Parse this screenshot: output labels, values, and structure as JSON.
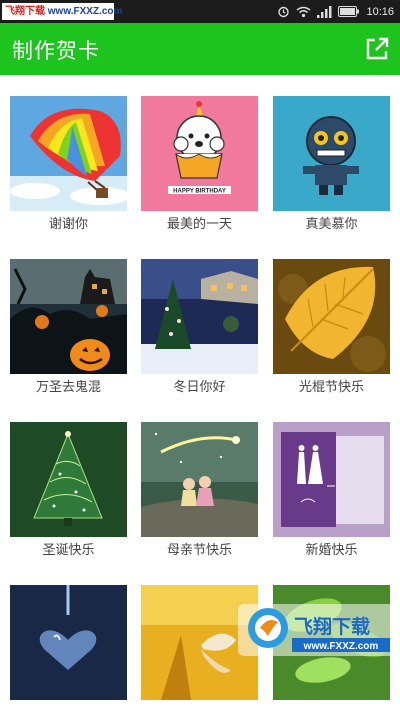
{
  "status_bar": {
    "watermark_red": "飞翔下载",
    "watermark_blue": " www.FXXZ.com",
    "time": "10:16",
    "icons": [
      "alarm-icon",
      "wifi-icon",
      "signal-icon",
      "battery-icon"
    ]
  },
  "app_bar": {
    "title": "制作贺卡",
    "share_icon": "share-icon",
    "color": "#1ec41e"
  },
  "cards": [
    {
      "label": "谢谢你",
      "image": "hot-air-balloon"
    },
    {
      "label": "最美的一天",
      "image": "birthday-cupcake"
    },
    {
      "label": "真美慕你",
      "image": "cartoon-robot"
    },
    {
      "label": "万圣去鬼混",
      "image": "halloween-night"
    },
    {
      "label": "冬日你好",
      "image": "winter-christmas-tree"
    },
    {
      "label": "光棍节快乐",
      "image": "autumn-leaf"
    },
    {
      "label": "圣诞快乐",
      "image": "green-christmas-tree"
    },
    {
      "label": "母亲节快乐",
      "image": "mothers-day-stars"
    },
    {
      "label": "新婚快乐",
      "image": "wedding-card"
    },
    {
      "label": "",
      "image": "water-heart"
    },
    {
      "label": "",
      "image": "butterfly-flower"
    },
    {
      "label": "",
      "image": "green-leaves"
    }
  ],
  "birthday_text": "HAPPY BIRTHDAY",
  "corner_watermark": {
    "logo_text": "飞翔下载",
    "url": "www.FXXZ.com"
  }
}
